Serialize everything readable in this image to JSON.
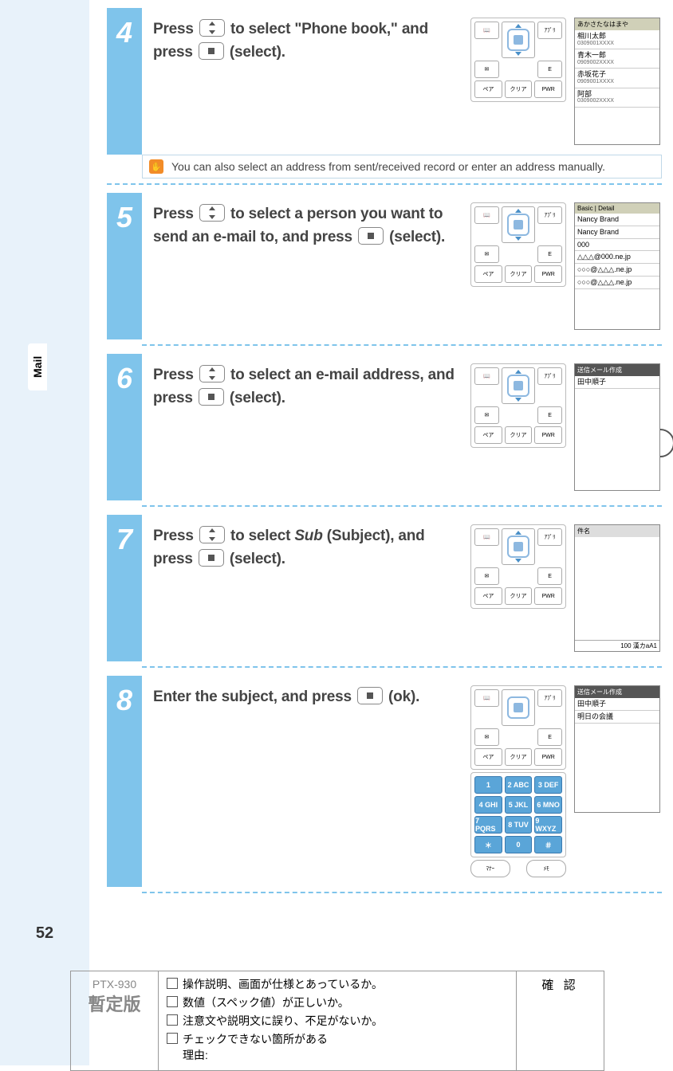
{
  "side_tab": "Mail",
  "page_number": "52",
  "steps": {
    "4": {
      "num": "4",
      "pre": "Press ",
      "mid": " to select \"Phone book,\" and press ",
      "post": " (select).",
      "tip": "You can also select an address from sent/received record or enter an address manually.",
      "screen": {
        "head": "あかさたなはまや",
        "rows": [
          {
            "name": "相川太郎",
            "sub": "0309001XXXX"
          },
          {
            "name": "青木一郎",
            "sub": "0909002XXXX"
          },
          {
            "name": "赤坂花子",
            "sub": "0909001XXXX"
          },
          {
            "name": "阿部",
            "sub": "0309002XXXX"
          }
        ]
      }
    },
    "5": {
      "num": "5",
      "pre": "Press ",
      "mid": " to select a person you want to send an e-mail to, and press ",
      "post": " (select).",
      "screen": {
        "head": "Basic | Detail",
        "rows": [
          {
            "name": "Nancy Brand",
            "sub": ""
          },
          {
            "name": "Nancy Brand",
            "sub": ""
          },
          {
            "name": "000",
            "sub": ""
          },
          {
            "name": "△△△@000.ne.jp",
            "sub": ""
          },
          {
            "name": "○○○@△△△.ne.jp",
            "sub": ""
          },
          {
            "name": "○○○@△△△.ne.jp",
            "sub": ""
          }
        ]
      }
    },
    "6": {
      "num": "6",
      "pre": "Press ",
      "mid": " to select an e-mail address, and press ",
      "post": " (select).",
      "screen": {
        "head": "送信メール作成",
        "rows": [
          {
            "name": "田中順子",
            "sub": ""
          }
        ]
      }
    },
    "7": {
      "num": "7",
      "pre": "Press ",
      "mid1": " to select ",
      "sub": "Sub",
      "mid2": " (Subject), and press ",
      "post": " (select).",
      "screen": {
        "head": "件名",
        "foot": "100 漢カaA1"
      }
    },
    "8": {
      "num": "8",
      "pre": "Enter the subject, and press ",
      "post": " (ok).",
      "screen": {
        "head": "送信メール作成",
        "rows": [
          {
            "name": "田中順子",
            "sub": ""
          },
          {
            "name": "明日の会議",
            "sub": ""
          }
        ]
      }
    }
  },
  "keypad": {
    "tl": "📖",
    "tr": "ｱﾌﾟﾘ",
    "bl": "✉",
    "br": "E",
    "r3a": "ペア",
    "r3b": "クリア",
    "r3c": "PWR"
  },
  "numpad": {
    "r1": [
      "1",
      "2 ABC",
      "3 DEF"
    ],
    "r2": [
      "4 GHI",
      "5 JKL",
      "6 MNO"
    ],
    "r3": [
      "7 PQRS",
      "8 TUV",
      "9 WXYZ"
    ],
    "r4": [
      "＊",
      "0",
      "＃"
    ],
    "foot_l": "ﾏﾅｰ",
    "foot_r": "ﾒﾓ"
  },
  "review": {
    "model": "PTX-930",
    "prov": "暫定版",
    "checks": [
      "操作説明、画面が仕様とあっているか。",
      "数値（スペック値）が正しいか。",
      "注意文や説明文に誤り、不足がないか。",
      "チェックできない箇所がある\n理由:"
    ],
    "confirm": "確 認"
  }
}
